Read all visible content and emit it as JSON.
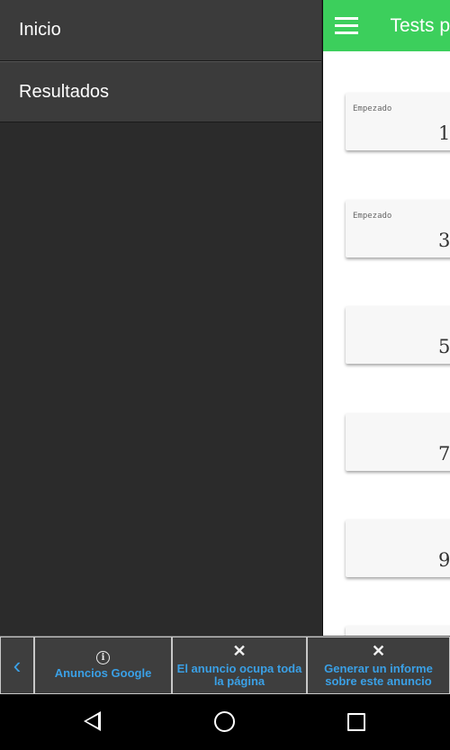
{
  "drawer": {
    "items": [
      {
        "label": "Inicio"
      },
      {
        "label": "Resultados"
      }
    ]
  },
  "appbar": {
    "title": "Tests p",
    "accent": "#3ccf5c"
  },
  "cards": [
    {
      "status": "Empezado",
      "number": "1"
    },
    {
      "status": "Empezado",
      "number": "3"
    },
    {
      "status": "",
      "number": "5"
    },
    {
      "status": "",
      "number": "7"
    },
    {
      "status": "",
      "number": "9"
    }
  ],
  "ad": {
    "google_label": "Anuncios Google",
    "full_page_label": "El anuncio ocupa toda la página",
    "report_label": "Generar un informe sobre este anuncio",
    "link_color": "#3aa0e6"
  },
  "icons": {
    "menu": "hamburger-icon",
    "back": "chevron-left-icon",
    "info": "info-icon",
    "close": "close-icon",
    "nav_back": "triangle-back-icon",
    "nav_home": "circle-home-icon",
    "nav_recent": "square-recents-icon"
  }
}
